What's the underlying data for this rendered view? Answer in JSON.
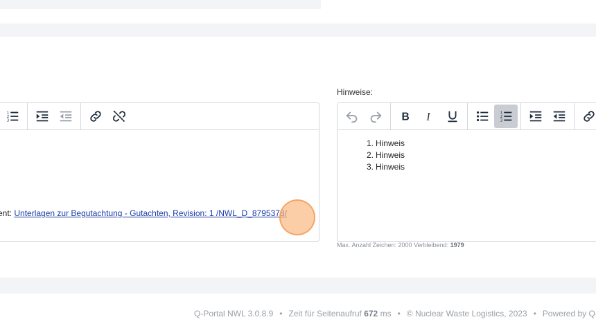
{
  "notes_label": "Hinweise:",
  "left_editor": {
    "content_prefix": "ent: ",
    "document_link": "Unterlagen zur Begutachtung - Gutachten, Revision: 1 /NWL_D_8795378/"
  },
  "right_editor": {
    "items": [
      {
        "number": "1.",
        "text": "Hinweis"
      },
      {
        "number": "2.",
        "text": "Hinweis"
      },
      {
        "number": "3.",
        "text": "Hinweis"
      }
    ]
  },
  "counter": {
    "text": "Max. Anzahl Zeichen: 2000 Verbleibend: ",
    "remaining": "1979"
  },
  "footer": {
    "version": "Q-Portal NWL 3.0.8.9",
    "load_label": "Zeit für Seitenaufruf ",
    "load_time": "672",
    "load_unit": " ms",
    "copyright": "© Nuclear Waste Logistics, 2023",
    "powered": "Powered by Q-P"
  },
  "icons": {
    "left_toolbar": [
      "numbered-list-icon",
      "indent-icon",
      "outdent-icon",
      "link-icon",
      "unlink-icon"
    ],
    "right_toolbar": [
      "undo-icon",
      "redo-icon",
      "bold-icon",
      "italic-icon",
      "underline-icon",
      "bullet-list-icon",
      "numbered-list-icon",
      "indent-icon",
      "outdent-icon",
      "link-icon"
    ]
  }
}
